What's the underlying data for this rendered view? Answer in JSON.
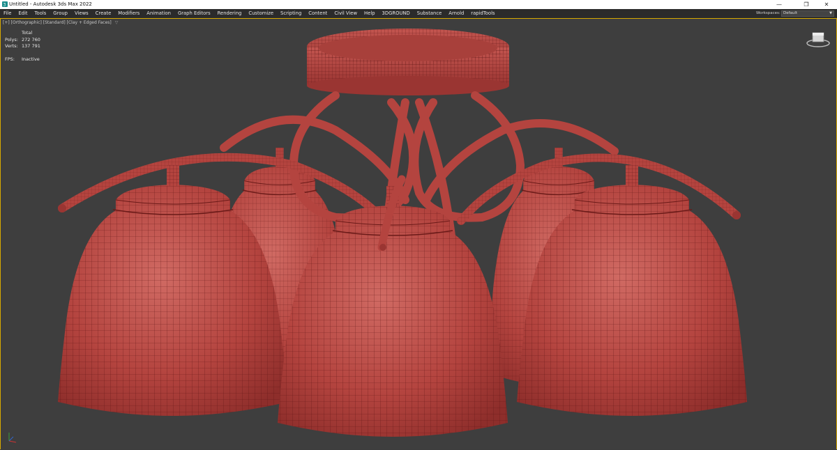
{
  "window": {
    "title": "Untitled - Autodesk 3ds Max 2022",
    "minimize": "—",
    "maximize": "❐",
    "close": "✕"
  },
  "menu": {
    "items": [
      "File",
      "Edit",
      "Tools",
      "Group",
      "Views",
      "Create",
      "Modifiers",
      "Animation",
      "Graph Editors",
      "Rendering",
      "Customize",
      "Scripting",
      "Content",
      "Civil View",
      "Help",
      "3DGROUND",
      "Substance",
      "Arnold",
      "rapidTools"
    ],
    "workspaces_label": "Workspaces:",
    "workspace_value": "Default"
  },
  "viewport": {
    "label": "[+] [Orthographic] [Standard] [Clay + Edged Faces]",
    "filter_icon": "filter-icon",
    "stats": {
      "header": "Total",
      "polys_label": "Polys:",
      "polys_value": "272 760",
      "verts_label": "Verts:",
      "verts_value": "137 791",
      "fps_label": "FPS:",
      "fps_value": "Inactive"
    }
  },
  "colors": {
    "viewport_bg": "#3e3e3e",
    "active_border": "#d8a900",
    "clay": "#b4443f",
    "wire": "#5a1212"
  },
  "icons": {
    "app": "3dsmax-app-icon",
    "viewcube": "viewcube-icon",
    "axis": "axis-tripod-icon"
  }
}
